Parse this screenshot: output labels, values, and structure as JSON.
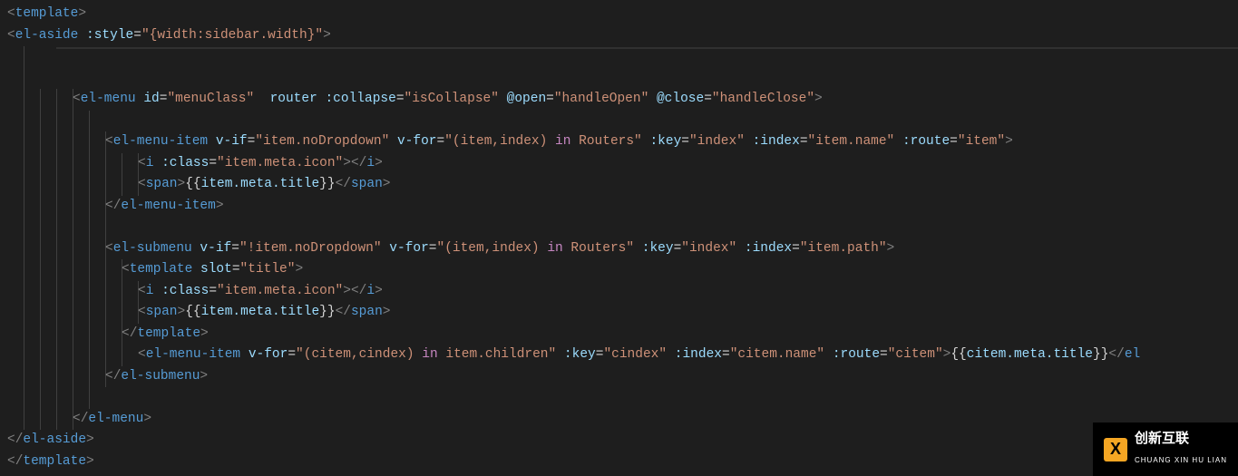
{
  "colors": {
    "background": "#1e1e1e",
    "tag": "#569cd6",
    "attr": "#9cdcfe",
    "string": "#ce9178",
    "punct": "#808080",
    "keyword": "#c586c0",
    "text": "#d4d4d4"
  },
  "watermark": {
    "title_cn": "创新互联",
    "sub": "CHUANG XIN HU LIAN"
  },
  "lines": [
    {
      "indent": 0,
      "guides": [],
      "tokens": [
        {
          "t": "<",
          "c": "gray"
        },
        {
          "t": "template",
          "c": "tag"
        },
        {
          "t": ">",
          "c": "gray"
        }
      ]
    },
    {
      "indent": 0,
      "guides": [],
      "tokens": [
        {
          "t": "<",
          "c": "gray"
        },
        {
          "t": "el-aside",
          "c": "tag"
        },
        {
          "t": " ",
          "c": "txt"
        },
        {
          "t": ":style",
          "c": "attr"
        },
        {
          "t": "=",
          "c": "txt"
        },
        {
          "t": "\"{width:sidebar.width}\"",
          "c": "str"
        },
        {
          "t": ">",
          "c": "gray"
        }
      ]
    },
    {
      "indent": 0,
      "guides": [
        1
      ],
      "blank": true,
      "tokens": []
    },
    {
      "indent": 0,
      "guides": [
        1
      ],
      "blank": true,
      "tokens": []
    },
    {
      "indent": 4,
      "guides": [
        1,
        2,
        3,
        4
      ],
      "tokens": [
        {
          "t": "<",
          "c": "gray"
        },
        {
          "t": "el-menu",
          "c": "tag"
        },
        {
          "t": " ",
          "c": "txt"
        },
        {
          "t": "id",
          "c": "attr"
        },
        {
          "t": "=",
          "c": "txt"
        },
        {
          "t": "\"menuClass\"",
          "c": "str"
        },
        {
          "t": "  ",
          "c": "txt"
        },
        {
          "t": "router",
          "c": "attr"
        },
        {
          "t": " ",
          "c": "txt"
        },
        {
          "t": ":collapse",
          "c": "attr"
        },
        {
          "t": "=",
          "c": "txt"
        },
        {
          "t": "\"isCollapse\"",
          "c": "str"
        },
        {
          "t": " ",
          "c": "txt"
        },
        {
          "t": "@open",
          "c": "attr"
        },
        {
          "t": "=",
          "c": "txt"
        },
        {
          "t": "\"handleOpen\"",
          "c": "str"
        },
        {
          "t": " ",
          "c": "txt"
        },
        {
          "t": "@close",
          "c": "attr"
        },
        {
          "t": "=",
          "c": "txt"
        },
        {
          "t": "\"handleClose\"",
          "c": "str"
        },
        {
          "t": ">",
          "c": "gray"
        }
      ]
    },
    {
      "indent": 4,
      "guides": [
        1,
        2,
        3,
        4,
        5
      ],
      "blank": true,
      "tokens": []
    },
    {
      "indent": 6,
      "guides": [
        1,
        2,
        3,
        4,
        5,
        6
      ],
      "tokens": [
        {
          "t": "<",
          "c": "gray"
        },
        {
          "t": "el-menu-item",
          "c": "tag"
        },
        {
          "t": " ",
          "c": "txt"
        },
        {
          "t": "v-if",
          "c": "attr"
        },
        {
          "t": "=",
          "c": "txt"
        },
        {
          "t": "\"item.noDropdown\"",
          "c": "str"
        },
        {
          "t": " ",
          "c": "txt"
        },
        {
          "t": "v-for",
          "c": "attr"
        },
        {
          "t": "=",
          "c": "txt"
        },
        {
          "t": "\"(item,index) ",
          "c": "str"
        },
        {
          "t": "in",
          "c": "kw"
        },
        {
          "t": " Routers\"",
          "c": "str"
        },
        {
          "t": " ",
          "c": "txt"
        },
        {
          "t": ":key",
          "c": "attr"
        },
        {
          "t": "=",
          "c": "txt"
        },
        {
          "t": "\"index\"",
          "c": "str"
        },
        {
          "t": " ",
          "c": "txt"
        },
        {
          "t": ":index",
          "c": "attr"
        },
        {
          "t": "=",
          "c": "txt"
        },
        {
          "t": "\"item.name\"",
          "c": "str"
        },
        {
          "t": " ",
          "c": "txt"
        },
        {
          "t": ":route",
          "c": "attr"
        },
        {
          "t": "=",
          "c": "txt"
        },
        {
          "t": "\"item\"",
          "c": "str"
        },
        {
          "t": ">",
          "c": "gray"
        }
      ]
    },
    {
      "indent": 8,
      "guides": [
        1,
        2,
        3,
        4,
        5,
        6,
        7,
        8
      ],
      "tokens": [
        {
          "t": "<",
          "c": "gray"
        },
        {
          "t": "i",
          "c": "tag"
        },
        {
          "t": " ",
          "c": "txt"
        },
        {
          "t": ":class",
          "c": "attr"
        },
        {
          "t": "=",
          "c": "txt"
        },
        {
          "t": "\"item.meta.icon\"",
          "c": "str"
        },
        {
          "t": "></",
          "c": "gray"
        },
        {
          "t": "i",
          "c": "tag"
        },
        {
          "t": ">",
          "c": "gray"
        }
      ]
    },
    {
      "indent": 8,
      "guides": [
        1,
        2,
        3,
        4,
        5,
        6,
        7,
        8
      ],
      "tokens": [
        {
          "t": "<",
          "c": "gray"
        },
        {
          "t": "span",
          "c": "tag"
        },
        {
          "t": ">",
          "c": "gray"
        },
        {
          "t": "{{",
          "c": "txt"
        },
        {
          "t": "item.meta.title",
          "c": "var"
        },
        {
          "t": "}}",
          "c": "txt"
        },
        {
          "t": "</",
          "c": "gray"
        },
        {
          "t": "span",
          "c": "tag"
        },
        {
          "t": ">",
          "c": "gray"
        }
      ]
    },
    {
      "indent": 6,
      "guides": [
        1,
        2,
        3,
        4,
        5,
        6
      ],
      "tokens": [
        {
          "t": "</",
          "c": "gray"
        },
        {
          "t": "el-menu-item",
          "c": "tag"
        },
        {
          "t": ">",
          "c": "gray"
        }
      ]
    },
    {
      "indent": 6,
      "guides": [
        1,
        2,
        3,
        4,
        5,
        6
      ],
      "blank": true,
      "tokens": []
    },
    {
      "indent": 6,
      "guides": [
        1,
        2,
        3,
        4,
        5,
        6
      ],
      "tokens": [
        {
          "t": "<",
          "c": "gray"
        },
        {
          "t": "el-submenu",
          "c": "tag"
        },
        {
          "t": " ",
          "c": "txt"
        },
        {
          "t": "v-if",
          "c": "attr"
        },
        {
          "t": "=",
          "c": "txt"
        },
        {
          "t": "\"!item.noDropdown\"",
          "c": "str"
        },
        {
          "t": " ",
          "c": "txt"
        },
        {
          "t": "v-for",
          "c": "attr"
        },
        {
          "t": "=",
          "c": "txt"
        },
        {
          "t": "\"(item,index) ",
          "c": "str"
        },
        {
          "t": "in",
          "c": "kw"
        },
        {
          "t": " Routers\"",
          "c": "str"
        },
        {
          "t": " ",
          "c": "txt"
        },
        {
          "t": ":key",
          "c": "attr"
        },
        {
          "t": "=",
          "c": "txt"
        },
        {
          "t": "\"index\"",
          "c": "str"
        },
        {
          "t": " ",
          "c": "txt"
        },
        {
          "t": ":index",
          "c": "attr"
        },
        {
          "t": "=",
          "c": "txt"
        },
        {
          "t": "\"item.path\"",
          "c": "str"
        },
        {
          "t": ">",
          "c": "gray"
        }
      ]
    },
    {
      "indent": 7,
      "guides": [
        1,
        2,
        3,
        4,
        5,
        6,
        7
      ],
      "tokens": [
        {
          "t": "<",
          "c": "gray"
        },
        {
          "t": "template",
          "c": "tag"
        },
        {
          "t": " ",
          "c": "txt"
        },
        {
          "t": "slot",
          "c": "attr"
        },
        {
          "t": "=",
          "c": "txt"
        },
        {
          "t": "\"title\"",
          "c": "str"
        },
        {
          "t": ">",
          "c": "gray"
        }
      ]
    },
    {
      "indent": 8,
      "guides": [
        1,
        2,
        3,
        4,
        5,
        6,
        7,
        8
      ],
      "tokens": [
        {
          "t": "<",
          "c": "gray"
        },
        {
          "t": "i",
          "c": "tag"
        },
        {
          "t": " ",
          "c": "txt"
        },
        {
          "t": ":class",
          "c": "attr"
        },
        {
          "t": "=",
          "c": "txt"
        },
        {
          "t": "\"item.meta.icon\"",
          "c": "str"
        },
        {
          "t": "></",
          "c": "gray"
        },
        {
          "t": "i",
          "c": "tag"
        },
        {
          "t": ">",
          "c": "gray"
        }
      ]
    },
    {
      "indent": 8,
      "guides": [
        1,
        2,
        3,
        4,
        5,
        6,
        7,
        8
      ],
      "tokens": [
        {
          "t": "<",
          "c": "gray"
        },
        {
          "t": "span",
          "c": "tag"
        },
        {
          "t": ">",
          "c": "gray"
        },
        {
          "t": "{{",
          "c": "txt"
        },
        {
          "t": "item.meta.title",
          "c": "var"
        },
        {
          "t": "}}",
          "c": "txt"
        },
        {
          "t": "</",
          "c": "gray"
        },
        {
          "t": "span",
          "c": "tag"
        },
        {
          "t": ">",
          "c": "gray"
        }
      ]
    },
    {
      "indent": 7,
      "guides": [
        1,
        2,
        3,
        4,
        5,
        6,
        7
      ],
      "tokens": [
        {
          "t": "</",
          "c": "gray"
        },
        {
          "t": "template",
          "c": "tag"
        },
        {
          "t": ">",
          "c": "gray"
        }
      ]
    },
    {
      "indent": 8,
      "guides": [
        1,
        2,
        3,
        4,
        5,
        6,
        7
      ],
      "tokens": [
        {
          "t": "<",
          "c": "gray"
        },
        {
          "t": "el-menu-item",
          "c": "tag"
        },
        {
          "t": " ",
          "c": "txt"
        },
        {
          "t": "v-for",
          "c": "attr"
        },
        {
          "t": "=",
          "c": "txt"
        },
        {
          "t": "\"(citem,cindex) ",
          "c": "str"
        },
        {
          "t": "in",
          "c": "kw"
        },
        {
          "t": " item.children\"",
          "c": "str"
        },
        {
          "t": " ",
          "c": "txt"
        },
        {
          "t": ":key",
          "c": "attr"
        },
        {
          "t": "=",
          "c": "txt"
        },
        {
          "t": "\"cindex\"",
          "c": "str"
        },
        {
          "t": " ",
          "c": "txt"
        },
        {
          "t": ":index",
          "c": "attr"
        },
        {
          "t": "=",
          "c": "txt"
        },
        {
          "t": "\"citem.name\"",
          "c": "str"
        },
        {
          "t": " ",
          "c": "txt"
        },
        {
          "t": ":route",
          "c": "attr"
        },
        {
          "t": "=",
          "c": "txt"
        },
        {
          "t": "\"citem\"",
          "c": "str"
        },
        {
          "t": ">",
          "c": "gray"
        },
        {
          "t": "{{",
          "c": "txt"
        },
        {
          "t": "citem.meta.title",
          "c": "var"
        },
        {
          "t": "}}",
          "c": "txt"
        },
        {
          "t": "</",
          "c": "gray"
        },
        {
          "t": "el",
          "c": "tag"
        }
      ]
    },
    {
      "indent": 6,
      "guides": [
        1,
        2,
        3,
        4,
        5,
        6
      ],
      "tokens": [
        {
          "t": "</",
          "c": "gray"
        },
        {
          "t": "el-submenu",
          "c": "tag"
        },
        {
          "t": ">",
          "c": "gray"
        }
      ]
    },
    {
      "indent": 6,
      "guides": [
        1,
        2,
        3,
        4,
        5
      ],
      "blank": true,
      "tokens": []
    },
    {
      "indent": 4,
      "guides": [
        1,
        2,
        3,
        4
      ],
      "tokens": [
        {
          "t": "</",
          "c": "gray"
        },
        {
          "t": "el-menu",
          "c": "tag"
        },
        {
          "t": ">",
          "c": "gray"
        }
      ]
    },
    {
      "indent": 0,
      "guides": [],
      "tokens": [
        {
          "t": "</",
          "c": "gray"
        },
        {
          "t": "el-aside",
          "c": "tag"
        },
        {
          "t": ">",
          "c": "gray"
        }
      ]
    },
    {
      "indent": 0,
      "guides": [],
      "tokens": [
        {
          "t": "</",
          "c": "gray"
        },
        {
          "t": "template",
          "c": "tag"
        },
        {
          "t": ">",
          "c": "gray"
        }
      ]
    }
  ]
}
